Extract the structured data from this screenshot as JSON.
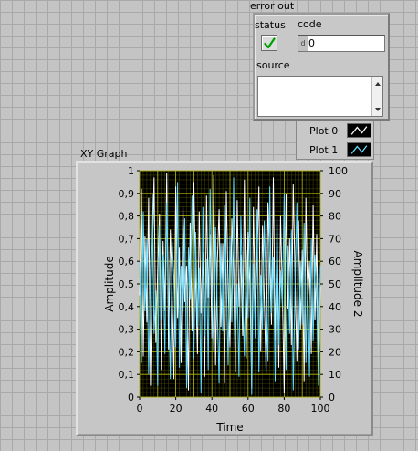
{
  "error_out": {
    "title": "error out",
    "status_label": "status",
    "code_label": "code",
    "code_radix": "d",
    "code_value": "0",
    "source_label": "source",
    "source_value": "",
    "status_icon": "checkmark-icon",
    "status_color": "#00a000"
  },
  "legend": {
    "items": [
      {
        "label": "Plot 0",
        "color": "#ffffff"
      },
      {
        "label": "Plot 1",
        "color": "#66ddff"
      }
    ]
  },
  "chart_data": {
    "type": "line",
    "title": "XY Graph",
    "xlabel": "Time",
    "ylabel": "Amplitude",
    "y2label": "Amplitude 2",
    "xlim": [
      0,
      100
    ],
    "ylim": [
      0,
      1
    ],
    "y2lim": [
      0,
      100
    ],
    "x_ticks": [
      "0",
      "20",
      "40",
      "60",
      "80",
      "100"
    ],
    "y_ticks": [
      "0",
      "0,1",
      "0,2",
      "0,3",
      "0,4",
      "0,5",
      "0,6",
      "0,7",
      "0,8",
      "0,9",
      "1"
    ],
    "y2_ticks": [
      "0",
      "10",
      "20",
      "30",
      "40",
      "50",
      "60",
      "70",
      "80",
      "90",
      "100"
    ],
    "background": "#000000",
    "grid_color": "#b8b800",
    "grid": true,
    "series": [
      {
        "name": "Plot 0",
        "color": "#ffffff",
        "x": [
          0,
          1,
          2,
          3,
          4,
          5,
          6,
          7,
          8,
          9,
          10,
          11,
          12,
          13,
          14,
          15,
          16,
          17,
          18,
          19,
          20,
          21,
          22,
          23,
          24,
          25,
          26,
          27,
          28,
          29,
          30,
          31,
          32,
          33,
          34,
          35,
          36,
          37,
          38,
          39,
          40,
          41,
          42,
          43,
          44,
          45,
          46,
          47,
          48,
          49,
          50,
          51,
          52,
          53,
          54,
          55,
          56,
          57,
          58,
          59,
          60,
          61,
          62,
          63,
          64,
          65,
          66,
          67,
          68,
          69,
          70,
          71,
          72,
          73,
          74,
          75,
          76,
          77,
          78,
          79,
          80,
          81,
          82,
          83,
          84,
          85,
          86,
          87,
          88,
          89,
          90,
          91,
          92,
          93,
          94,
          95,
          96,
          97,
          98,
          99,
          100
        ],
        "y": [
          0.45,
          0.92,
          0.18,
          0.71,
          0.33,
          0.88,
          0.05,
          0.62,
          0.97,
          0.24,
          0.56,
          0.81,
          0.12,
          0.69,
          0.38,
          0.99,
          0.21,
          0.74,
          0.47,
          0.08,
          0.93,
          0.35,
          0.66,
          0.15,
          0.85,
          0.42,
          0.58,
          0.03,
          0.77,
          0.29,
          0.95,
          0.51,
          0.19,
          0.82,
          0.37,
          0.64,
          0.09,
          0.89,
          0.44,
          0.72,
          0.26,
          0.98,
          0.14,
          0.59,
          0.83,
          0.31,
          0.68,
          0.06,
          0.91,
          0.48,
          0.22,
          0.79,
          0.55,
          0.11,
          0.87,
          0.4,
          0.63,
          0.27,
          0.96,
          0.17,
          0.73,
          0.5,
          0.04,
          0.84,
          0.36,
          0.61,
          0.93,
          0.2,
          0.76,
          0.43,
          0.1,
          0.86,
          0.57,
          0.32,
          0.97,
          0.25,
          0.67,
          0.13,
          0.8,
          0.46,
          0.02,
          0.9,
          0.39,
          0.7,
          0.23,
          0.94,
          0.53,
          0.16,
          0.78,
          0.3,
          0.65,
          0.07,
          0.88,
          0.41,
          0.6,
          0.19,
          0.85,
          0.34,
          0.72,
          0.11,
          0.49
        ]
      },
      {
        "name": "Plot 1",
        "color": "#66ddff",
        "x": [
          0,
          1,
          2,
          3,
          4,
          5,
          6,
          7,
          8,
          9,
          10,
          11,
          12,
          13,
          14,
          15,
          16,
          17,
          18,
          19,
          20,
          21,
          22,
          23,
          24,
          25,
          26,
          27,
          28,
          29,
          30,
          31,
          32,
          33,
          34,
          35,
          36,
          37,
          38,
          39,
          40,
          41,
          42,
          43,
          44,
          45,
          46,
          47,
          48,
          49,
          50,
          51,
          52,
          53,
          54,
          55,
          56,
          57,
          58,
          59,
          60,
          61,
          62,
          63,
          64,
          65,
          66,
          67,
          68,
          69,
          70,
          71,
          72,
          73,
          74,
          75,
          76,
          77,
          78,
          79,
          80,
          81,
          82,
          83,
          84,
          85,
          86,
          87,
          88,
          89,
          90,
          91,
          92,
          93,
          94,
          95,
          96,
          97,
          98,
          99,
          100
        ],
        "y": [
          0.6,
          0.15,
          0.82,
          0.38,
          0.7,
          0.1,
          0.55,
          0.9,
          0.28,
          0.47,
          0.05,
          0.76,
          0.34,
          0.63,
          0.19,
          0.86,
          0.41,
          0.08,
          0.69,
          0.52,
          0.22,
          0.95,
          0.13,
          0.58,
          0.36,
          0.79,
          0.04,
          0.66,
          0.43,
          0.89,
          0.17,
          0.73,
          0.31,
          0.57,
          0.02,
          0.84,
          0.27,
          0.61,
          0.12,
          0.92,
          0.48,
          0.2,
          0.75,
          0.39,
          0.06,
          0.68,
          0.29,
          0.85,
          0.53,
          0.14,
          0.71,
          0.33,
          0.97,
          0.24,
          0.5,
          0.09,
          0.8,
          0.44,
          0.18,
          0.65,
          0.35,
          0.88,
          0.01,
          0.59,
          0.26,
          0.83,
          0.11,
          0.54,
          0.3,
          0.78,
          0.46,
          0.16,
          0.93,
          0.37,
          0.62,
          0.07,
          0.81,
          0.23,
          0.56,
          0.4,
          0.9,
          0.12,
          0.67,
          0.28,
          0.74,
          0.03,
          0.49,
          0.86,
          0.21,
          0.6,
          0.32,
          0.77,
          0.15,
          0.52,
          0.09,
          0.7,
          0.25,
          0.63,
          0.42,
          0.05,
          0.58
        ]
      }
    ]
  }
}
